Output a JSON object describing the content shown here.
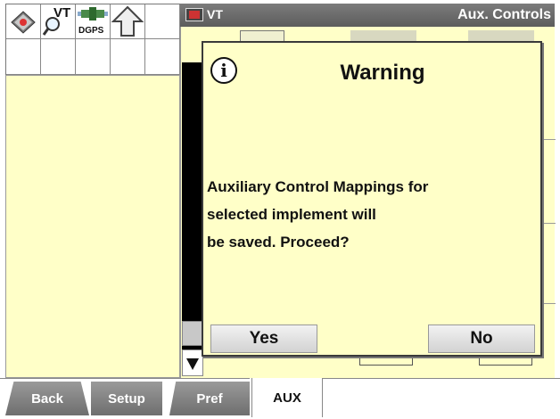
{
  "status_bar": {
    "vt_label": "VT",
    "dgps_label": "DGPS"
  },
  "titlebar": {
    "vt_label": "VT",
    "title": "Aux. Controls"
  },
  "dialog": {
    "title": "Warning",
    "message_lines": [
      "Auxiliary Control Mappings for",
      "selected implement will",
      "be saved. Proceed?"
    ],
    "yes_label": "Yes",
    "no_label": "No"
  },
  "tabs": [
    {
      "label": "Back"
    },
    {
      "label": "Setup"
    },
    {
      "label": "Pref"
    },
    {
      "label": "AUX",
      "active": true
    }
  ]
}
